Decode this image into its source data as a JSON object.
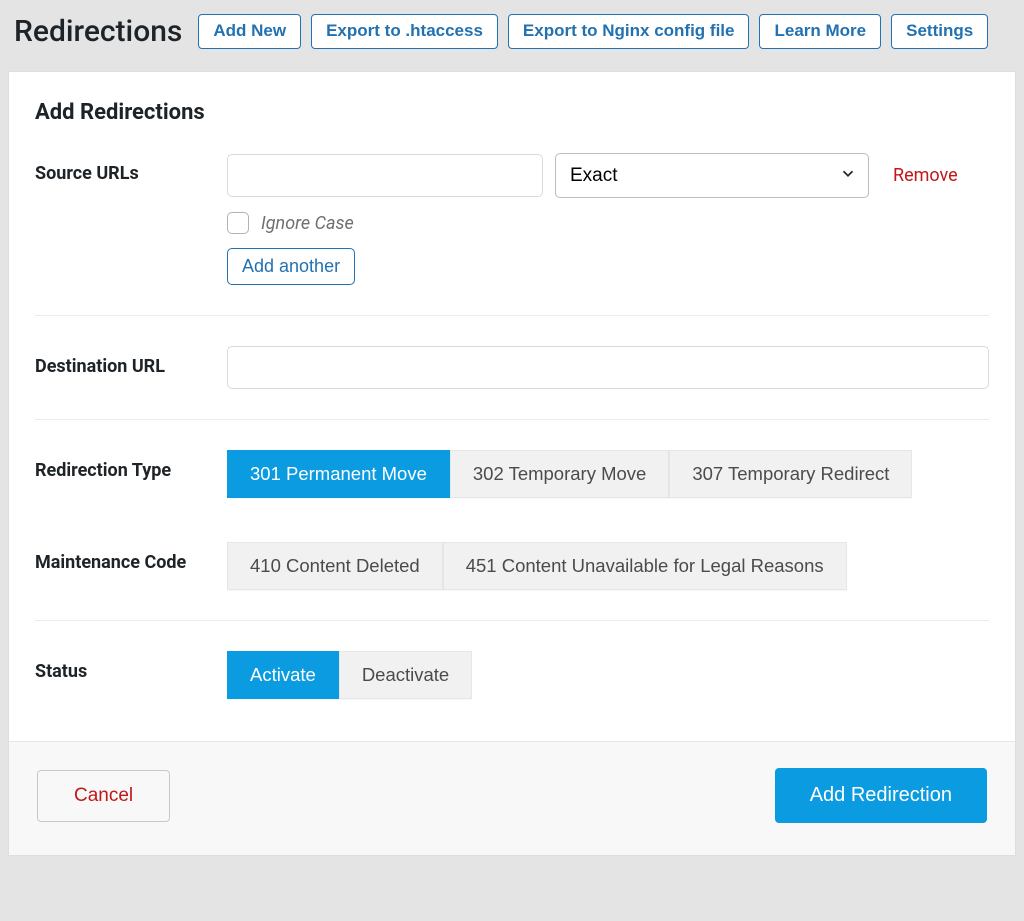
{
  "header": {
    "title": "Redirections",
    "buttons": {
      "add_new": "Add New",
      "export_htaccess": "Export to .htaccess",
      "export_nginx": "Export to Nginx config file",
      "learn_more": "Learn More",
      "settings": "Settings"
    }
  },
  "panel": {
    "title": "Add Redirections"
  },
  "form": {
    "source": {
      "label": "Source URLs",
      "url_value": "",
      "match_type": "Exact",
      "remove": "Remove",
      "ignore_case": "Ignore Case",
      "add_another": "Add another"
    },
    "destination": {
      "label": "Destination URL",
      "value": ""
    },
    "redirection_type": {
      "label": "Redirection Type",
      "options": {
        "r301": "301 Permanent Move",
        "r302": "302 Temporary Move",
        "r307": "307 Temporary Redirect"
      }
    },
    "maintenance_code": {
      "label": "Maintenance Code",
      "options": {
        "c410": "410 Content Deleted",
        "c451": "451 Content Unavailable for Legal Reasons"
      }
    },
    "status": {
      "label": "Status",
      "activate": "Activate",
      "deactivate": "Deactivate"
    }
  },
  "actions": {
    "cancel": "Cancel",
    "submit": "Add Redirection"
  }
}
